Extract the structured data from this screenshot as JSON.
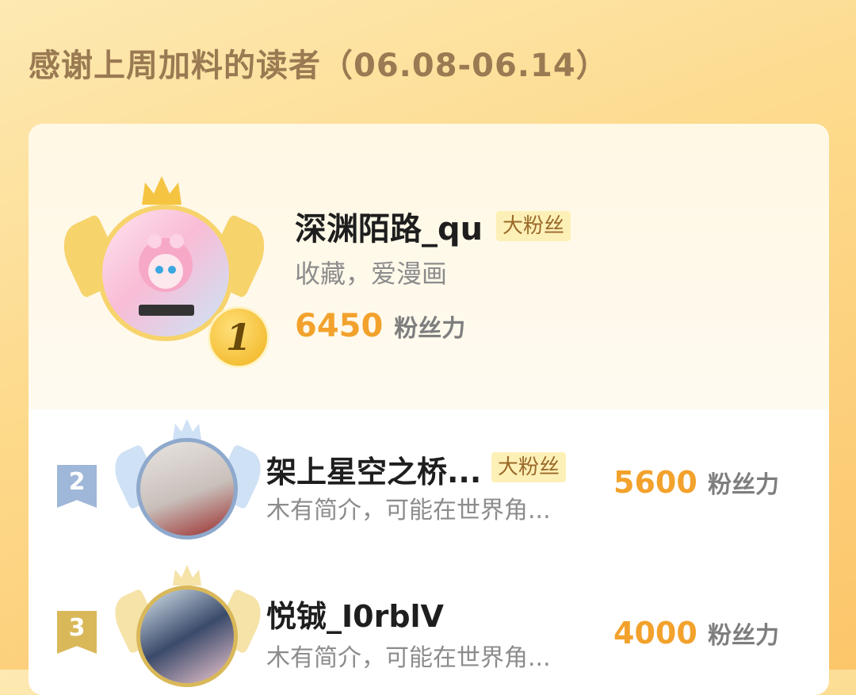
{
  "title": "感谢上周加料的读者（06.08-06.14）",
  "readers": [
    {
      "rank": "1",
      "name": "深渊陌路_qu",
      "badge": "大粉丝",
      "desc": "收藏，爱漫画",
      "score": "6450",
      "unit": "粉丝力"
    },
    {
      "rank": "2",
      "name": "架上星空之桥...",
      "badge": "大粉丝",
      "desc": "木有简介，可能在世界角...",
      "score": "5600",
      "unit": "粉丝力"
    },
    {
      "rank": "3",
      "name": "悦铖_I0rblV",
      "desc": "木有简介，可能在世界角...",
      "score": "4000",
      "unit": "粉丝力"
    }
  ],
  "colors": {
    "accent": "#f2a22c",
    "title": "#9a7a52",
    "gold": "#f5c542",
    "silver_flag": "#9fb7d8",
    "bronze_flag": "#d9b85a"
  },
  "icons": [
    "crown-icon",
    "wing-icon",
    "rank-medal",
    "rank-flag"
  ]
}
